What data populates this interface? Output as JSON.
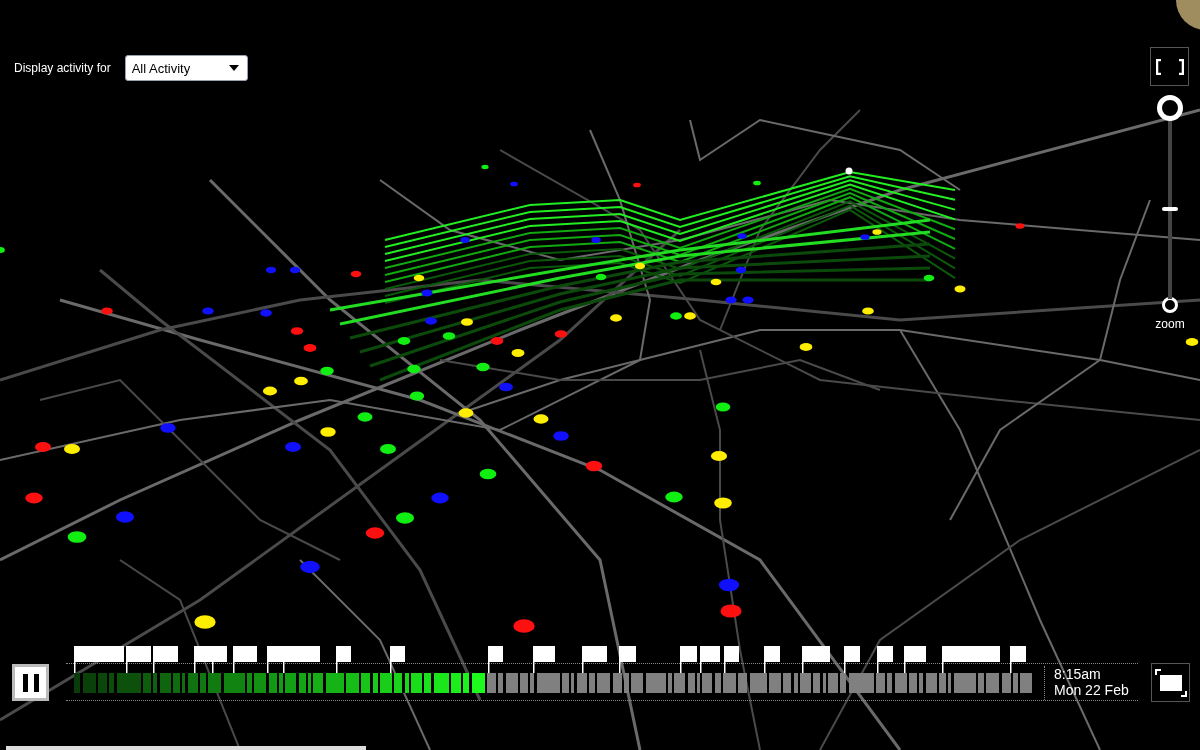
{
  "activity_filter": {
    "label": "Display activity for",
    "value": "All Activity"
  },
  "zoom": {
    "label": "zoom",
    "level": 0.5
  },
  "playback": {
    "playing": true
  },
  "timeline": {
    "level": 0.43,
    "time": "8:15am",
    "date": "Mon 22 Feb"
  }
}
